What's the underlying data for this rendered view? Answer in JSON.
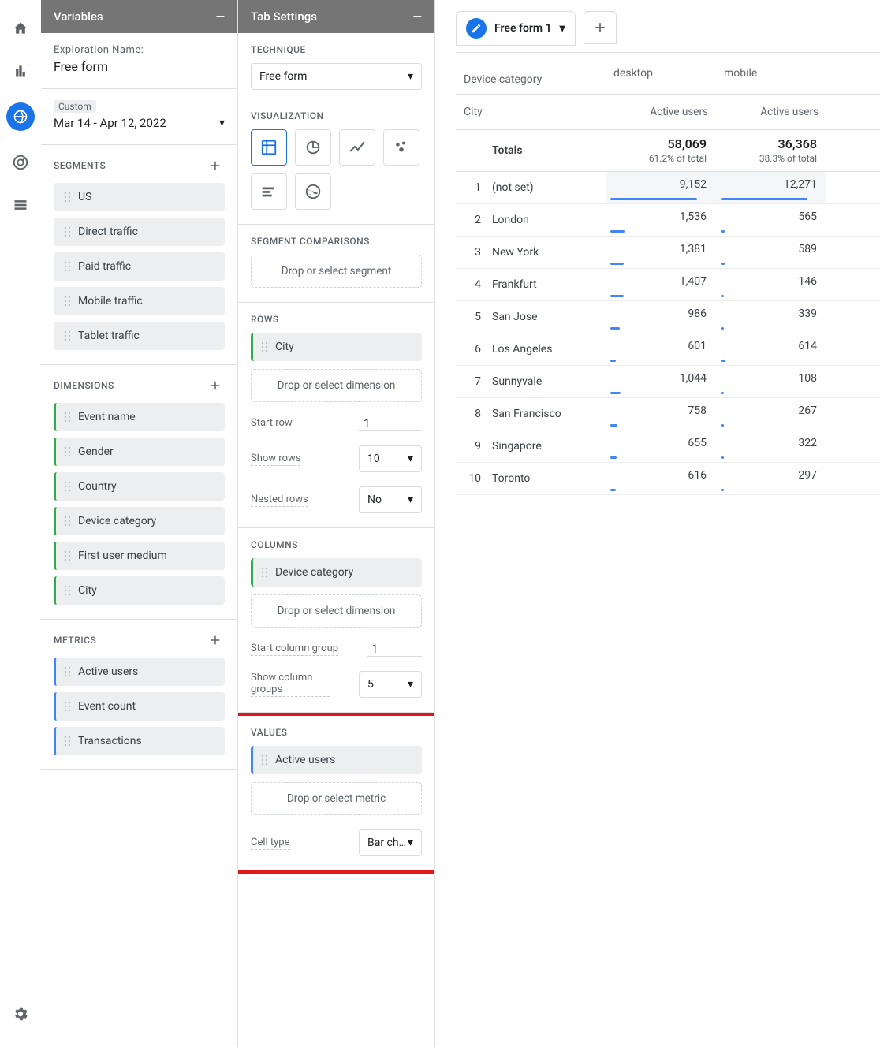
{
  "rail": {
    "items": [
      "home",
      "reports",
      "explore",
      "advertising",
      "configure"
    ],
    "active_index": 2
  },
  "variables_panel": {
    "title": "Variables",
    "exploration_name_label": "Exploration Name:",
    "exploration_name_value": "Free form",
    "date_custom_pill": "Custom",
    "date_range": "Mar 14 - Apr 12, 2022",
    "segments": {
      "title": "SEGMENTS",
      "items": [
        "US",
        "Direct traffic",
        "Paid traffic",
        "Mobile traffic",
        "Tablet traffic"
      ]
    },
    "dimensions": {
      "title": "DIMENSIONS",
      "items": [
        "Event name",
        "Gender",
        "Country",
        "Device category",
        "First user medium",
        "City"
      ]
    },
    "metrics": {
      "title": "METRICS",
      "items": [
        "Active users",
        "Event count",
        "Transactions"
      ]
    }
  },
  "settings_panel": {
    "title": "Tab Settings",
    "technique": {
      "title": "TECHNIQUE",
      "value": "Free form"
    },
    "visualization": {
      "title": "VISUALIZATION"
    },
    "segment_comparisons": {
      "title": "SEGMENT COMPARISONS",
      "drop_label": "Drop or select segment"
    },
    "rows": {
      "title": "ROWS",
      "items": [
        "City"
      ],
      "drop_label": "Drop or select dimension",
      "start_row_label": "Start row",
      "start_row_value": "1",
      "show_rows_label": "Show rows",
      "show_rows_value": "10",
      "nested_label": "Nested rows",
      "nested_value": "No"
    },
    "columns": {
      "title": "COLUMNS",
      "items": [
        "Device category"
      ],
      "drop_label": "Drop or select dimension",
      "start_group_label": "Start column group",
      "start_group_value": "1",
      "show_groups_label": "Show column groups",
      "show_groups_value": "5"
    },
    "values": {
      "title": "VALUES",
      "items": [
        "Active users"
      ],
      "drop_label": "Drop or select metric",
      "cell_type_label": "Cell type",
      "cell_type_value": "Bar ch…"
    }
  },
  "report": {
    "tab_name": "Free form 1",
    "col_header_label": "Device category",
    "row_header_label": "City",
    "metric_label": "Active users",
    "col_groups": [
      "desktop",
      "mobile"
    ],
    "totals": {
      "label": "Totals",
      "desktop": "58,069",
      "desktop_pct": "61.2% of total",
      "mobile": "36,368",
      "mobile_pct": "38.3% of total"
    }
  },
  "chart_data": {
    "type": "table",
    "row_dimension": "City",
    "column_dimension": "Device category",
    "metric": "Active users",
    "columns": [
      "desktop",
      "mobile"
    ],
    "totals": {
      "desktop": 58069,
      "mobile": 36368,
      "desktop_pct_of_total": 61.2,
      "mobile_pct_of_total": 38.3
    },
    "rows": [
      {
        "idx": 1,
        "city": "(not set)",
        "desktop": 9152,
        "mobile": 12271
      },
      {
        "idx": 2,
        "city": "London",
        "desktop": 1536,
        "mobile": 565
      },
      {
        "idx": 3,
        "city": "New York",
        "desktop": 1381,
        "mobile": 589
      },
      {
        "idx": 4,
        "city": "Frankfurt",
        "desktop": 1407,
        "mobile": 146
      },
      {
        "idx": 5,
        "city": "San Jose",
        "desktop": 986,
        "mobile": 339
      },
      {
        "idx": 6,
        "city": "Los Angeles",
        "desktop": 601,
        "mobile": 614
      },
      {
        "idx": 7,
        "city": "Sunnyvale",
        "desktop": 1044,
        "mobile": 108
      },
      {
        "idx": 8,
        "city": "San Francisco",
        "desktop": 758,
        "mobile": 267
      },
      {
        "idx": 9,
        "city": "Singapore",
        "desktop": 655,
        "mobile": 322
      },
      {
        "idx": 10,
        "city": "Toronto",
        "desktop": 616,
        "mobile": 297
      }
    ]
  }
}
